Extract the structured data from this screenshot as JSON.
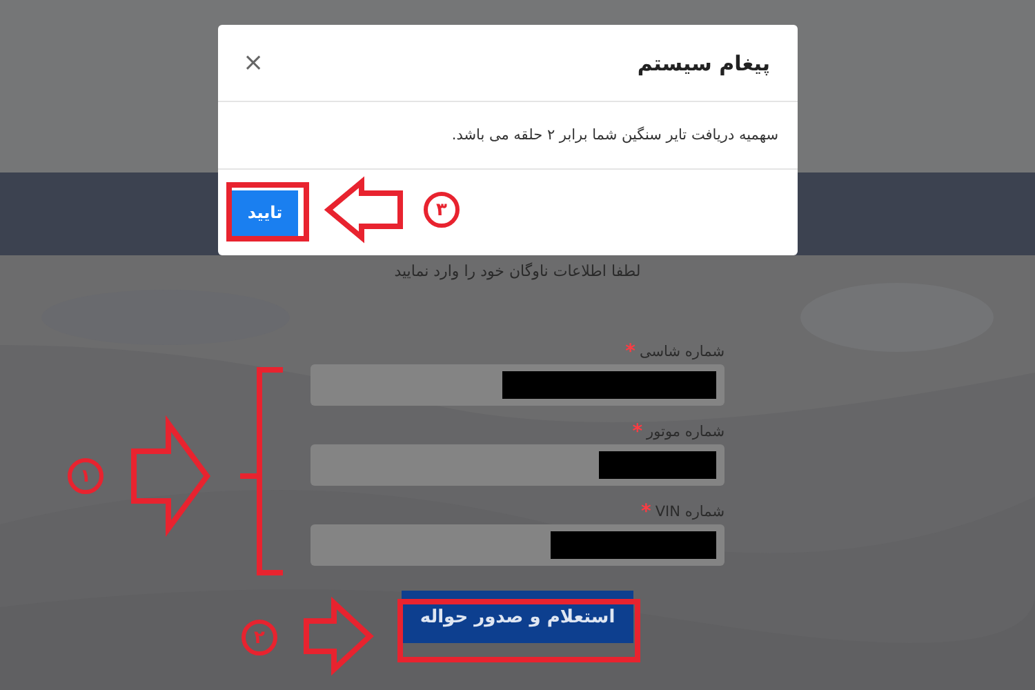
{
  "page": {
    "instruction": "لطفا اطلاعات ناوگان خود را وارد نمایید",
    "fields": [
      {
        "label": "شماره شاسی",
        "required_mark": "*",
        "redacted": true
      },
      {
        "label": "شماره موتور",
        "required_mark": "*",
        "redacted": true
      },
      {
        "label": "شماره VIN",
        "required_mark": "*",
        "redacted": true
      }
    ],
    "submit_button": "استعلام و صدور حواله"
  },
  "dialog": {
    "title": "پیغام سیستم",
    "close": "×",
    "message": "سهمیه دریافت تایر سنگین شما برابر ۲ حلقه می باشد.",
    "confirm_button": "تایید"
  },
  "annotations": [
    {
      "number": "۱"
    },
    {
      "number": "۲"
    },
    {
      "number": "۳"
    }
  ]
}
